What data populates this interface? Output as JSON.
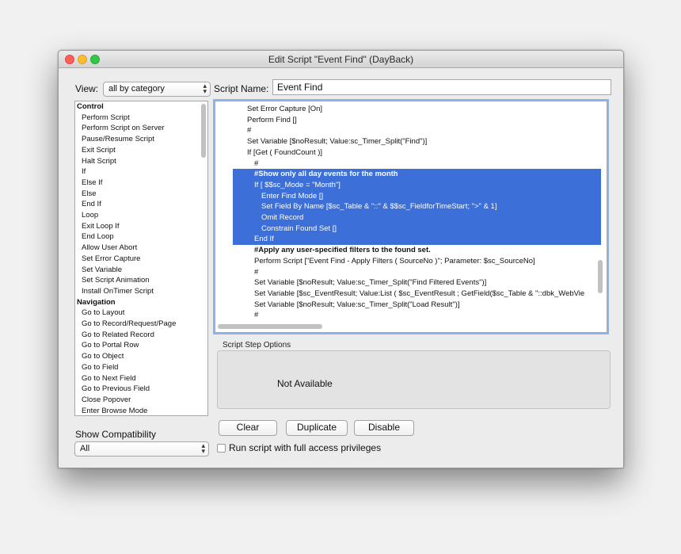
{
  "window": {
    "title": "Edit Script \"Event Find\" (DayBack)"
  },
  "view": {
    "label": "View:",
    "selected": "all by category"
  },
  "script_name": {
    "label": "Script Name:",
    "value": "Event Find"
  },
  "steps_list": [
    {
      "text": "Control",
      "category": true
    },
    {
      "text": "Perform Script",
      "category": false
    },
    {
      "text": "Perform Script on Server",
      "category": false
    },
    {
      "text": "Pause/Resume Script",
      "category": false
    },
    {
      "text": "Exit Script",
      "category": false
    },
    {
      "text": "Halt Script",
      "category": false
    },
    {
      "text": "If",
      "category": false
    },
    {
      "text": "Else If",
      "category": false
    },
    {
      "text": "Else",
      "category": false
    },
    {
      "text": "End If",
      "category": false
    },
    {
      "text": "Loop",
      "category": false
    },
    {
      "text": "Exit Loop If",
      "category": false
    },
    {
      "text": "End Loop",
      "category": false
    },
    {
      "text": "Allow User Abort",
      "category": false
    },
    {
      "text": "Set Error Capture",
      "category": false
    },
    {
      "text": "Set Variable",
      "category": false
    },
    {
      "text": "Set Script Animation",
      "category": false
    },
    {
      "text": "Install OnTimer Script",
      "category": false
    },
    {
      "text": "Navigation",
      "category": true
    },
    {
      "text": "Go to Layout",
      "category": false
    },
    {
      "text": "Go to Record/Request/Page",
      "category": false
    },
    {
      "text": "Go to Related Record",
      "category": false
    },
    {
      "text": "Go to Portal Row",
      "category": false
    },
    {
      "text": "Go to Object",
      "category": false
    },
    {
      "text": "Go to Field",
      "category": false
    },
    {
      "text": "Go to Next Field",
      "category": false
    },
    {
      "text": "Go to Previous Field",
      "category": false
    },
    {
      "text": "Close Popover",
      "category": false
    },
    {
      "text": "Enter Browse Mode",
      "category": false
    }
  ],
  "script_lines": [
    {
      "text": "Set Error Capture [On]",
      "indent": 0,
      "selected": false,
      "bold": false
    },
    {
      "text": "Perform Find []",
      "indent": 0,
      "selected": false,
      "bold": false
    },
    {
      "text": "#",
      "indent": 0,
      "selected": false,
      "bold": false
    },
    {
      "text": "Set Variable [$noResult; Value:sc_Timer_Split(\"Find\")]",
      "indent": 0,
      "selected": false,
      "bold": false
    },
    {
      "text": "If [Get ( FoundCount )]",
      "indent": 0,
      "selected": false,
      "bold": false
    },
    {
      "text": "#",
      "indent": 1,
      "selected": false,
      "bold": false
    },
    {
      "text": "#Show only all day events for the month",
      "indent": 1,
      "selected": true,
      "bold": true
    },
    {
      "text": "If [ $$sc_Mode = \"Month\"]",
      "indent": 1,
      "selected": true,
      "bold": false
    },
    {
      "text": "Enter Find Mode []",
      "indent": 2,
      "selected": true,
      "bold": false
    },
    {
      "text": "Set Field By Name [$sc_Table & \"::\" & $$sc_FieldforTimeStart; \">\" & 1]",
      "indent": 2,
      "selected": true,
      "bold": false
    },
    {
      "text": "Omit Record",
      "indent": 2,
      "selected": true,
      "bold": false
    },
    {
      "text": "Constrain Found Set []",
      "indent": 2,
      "selected": true,
      "bold": false
    },
    {
      "text": "End If",
      "indent": 1,
      "selected": true,
      "bold": false
    },
    {
      "text": "#Apply any user-specified filters to the found set.",
      "indent": 1,
      "selected": false,
      "bold": true
    },
    {
      "text": "Perform Script [\"Event Find - Apply Filters ( SourceNo )\"; Parameter: $sc_SourceNo]",
      "indent": 1,
      "selected": false,
      "bold": false
    },
    {
      "text": "#",
      "indent": 1,
      "selected": false,
      "bold": false
    },
    {
      "text": "Set Variable [$noResult; Value:sc_Timer_Split(\"Find Filtered Events\")]",
      "indent": 1,
      "selected": false,
      "bold": false
    },
    {
      "text": "Set Variable [$sc_EventResult; Value:List ( $sc_EventResult ; GetField($sc_Table & \"::dbk_WebVie",
      "indent": 1,
      "selected": false,
      "bold": false
    },
    {
      "text": "Set Variable [$noResult; Value:sc_Timer_Split(\"Load Result\")]",
      "indent": 1,
      "selected": false,
      "bold": false
    },
    {
      "text": "#",
      "indent": 1,
      "selected": false,
      "bold": false
    }
  ],
  "options": {
    "label": "Script Step Options",
    "status": "Not Available"
  },
  "buttons": {
    "clear": "Clear",
    "duplicate": "Duplicate",
    "disable": "Disable"
  },
  "compat": {
    "label": "Show Compatibility",
    "selected": "All"
  },
  "full_access": {
    "label": "Run script with full access privileges",
    "checked": false
  },
  "colors": {
    "selection": "#3c6fd8",
    "focus_ring": "#8fb4ea"
  }
}
